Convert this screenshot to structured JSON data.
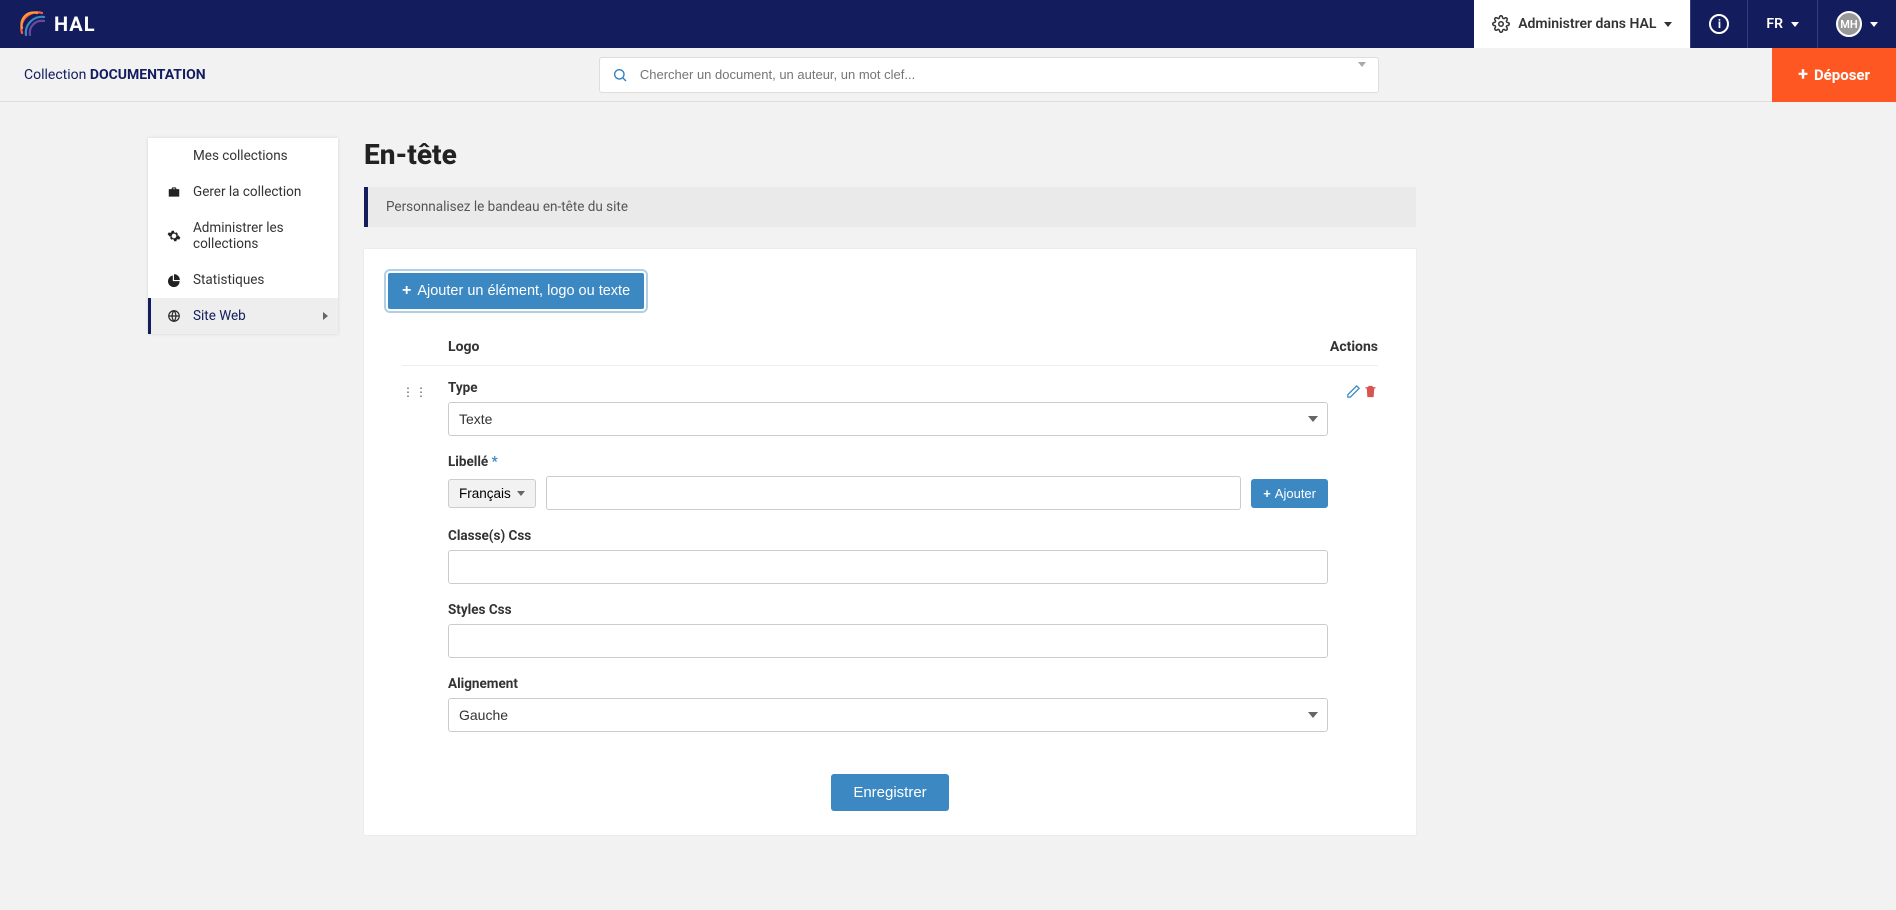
{
  "topbar": {
    "logo_text": "HAL",
    "admin_label": "Administrer dans HAL",
    "lang": "FR",
    "avatar_initials": "MH",
    "info_glyph": "i"
  },
  "subbar": {
    "collection_prefix": "Collection ",
    "collection_name": "DOCUMENTATION",
    "search_placeholder": "Chercher un document, un auteur, un mot clef...",
    "deposer_label": "Déposer"
  },
  "sidebar": {
    "items": [
      {
        "label": "Mes collections",
        "icon": ""
      },
      {
        "label": "Gerer la collection",
        "icon": "briefcase"
      },
      {
        "label": "Administrer les collections",
        "icon": "gear"
      },
      {
        "label": "Statistiques",
        "icon": "pie"
      },
      {
        "label": "Site Web",
        "icon": "globe"
      }
    ],
    "active_index": 4
  },
  "page": {
    "title": "En-tête",
    "info": "Personnalisez le bandeau en-tête du site",
    "add_button": "Ajouter un élément, logo ou texte",
    "columns": {
      "logo": "Logo",
      "actions": "Actions"
    },
    "save_button": "Enregistrer"
  },
  "form": {
    "type_label": "Type",
    "type_value": "Texte",
    "libelle_label": "Libellé",
    "lang_button": "Français",
    "libelle_value": "",
    "ajouter_label": "Ajouter",
    "css_classes_label": "Classe(s) Css",
    "css_classes_value": "",
    "css_styles_label": "Styles Css",
    "css_styles_value": "",
    "align_label": "Alignement",
    "align_value": "Gauche"
  }
}
